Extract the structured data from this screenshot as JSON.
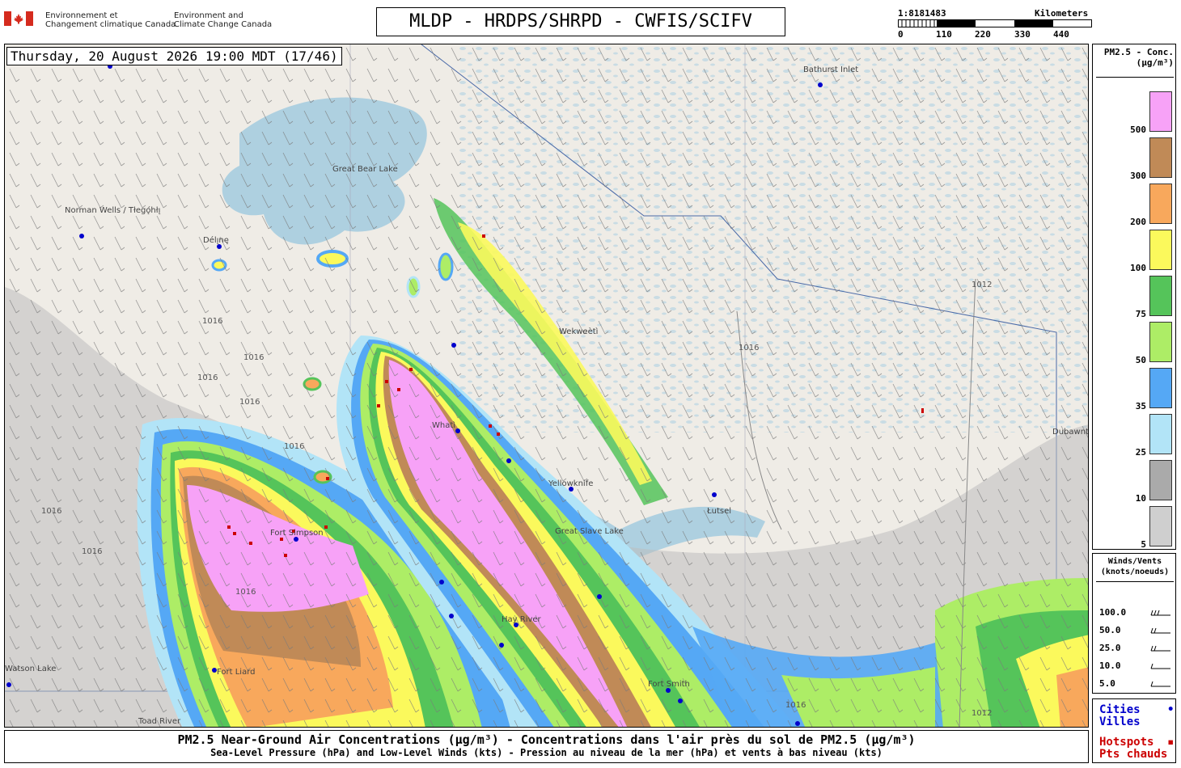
{
  "header": {
    "dept_fr": [
      "Environnement et",
      "Changement climatique Canada"
    ],
    "dept_en": [
      "Environment and",
      "Climate Change Canada"
    ],
    "title": "MLDP - HRDPS/SHRPD - CWFIS/SCIFV"
  },
  "scale": {
    "ratio": "1:8181483",
    "units": "Kilometers",
    "ticks": [
      "0",
      "110",
      "220",
      "330",
      "440"
    ]
  },
  "map": {
    "timestamp": "Thursday, 20 August 2026 19:00 MDT (17/46)",
    "places": [
      "Bathurst Inlet",
      "Great Bear Lake",
      "Norman Wells / Tłegǫ́hłı̨",
      "Délı̨nę",
      "Wekweètì",
      "Whatì",
      "Yellowknife",
      "Great Slave Lake",
      "Łutsel",
      "Fort Simpson",
      "Hay River",
      "Fort Liard",
      "Fort Smith",
      "Toad River",
      "Dubawnt Lake",
      "Watson Lake"
    ],
    "isobars": [
      "1016",
      "1016",
      "1016",
      "1016",
      "1016",
      "1016",
      "1016",
      "1016",
      "1016",
      "1012",
      "1012",
      "1016"
    ]
  },
  "legend": {
    "title_1": "PM2.5 - Conc.",
    "title_2": "(µg/m³)",
    "levels": [
      {
        "label": "500",
        "color": "#f7a2f7"
      },
      {
        "label": "300",
        "color": "#c08a57"
      },
      {
        "label": "200",
        "color": "#f8a85c"
      },
      {
        "label": "100",
        "color": "#fbf95c"
      },
      {
        "label": "75",
        "color": "#55c45a"
      },
      {
        "label": "50",
        "color": "#aded66"
      },
      {
        "label": "35",
        "color": "#55a8f5"
      },
      {
        "label": "25",
        "color": "#b2e4f7"
      },
      {
        "label": "10",
        "color": "#aaaaaa"
      },
      {
        "label": "5",
        "color": "#cfcfcf"
      }
    ]
  },
  "winds": {
    "title_1": "Winds/Vents",
    "title_2": "(knots/noeuds)",
    "values": [
      "100.0",
      "50.0",
      "25.0",
      "10.0",
      "5.0"
    ]
  },
  "cities_box": {
    "cities": "Cities",
    "villes": "Villes",
    "hotspots": "Hotspots",
    "pts": "Pts chauds",
    "city_color": "#0000cc",
    "hotspot_color": "#cc0000"
  },
  "footer": {
    "line1": "PM2.5 Near-Ground Air Concentrations (µg/m³) - Concentrations dans l'air près du sol de PM2.5 (µg/m³)",
    "line2": "Sea-Level Pressure (hPa) and Low-Level Winds (kts) - Pression au niveau de la mer (hPa) et vents à bas niveau (kts)"
  }
}
